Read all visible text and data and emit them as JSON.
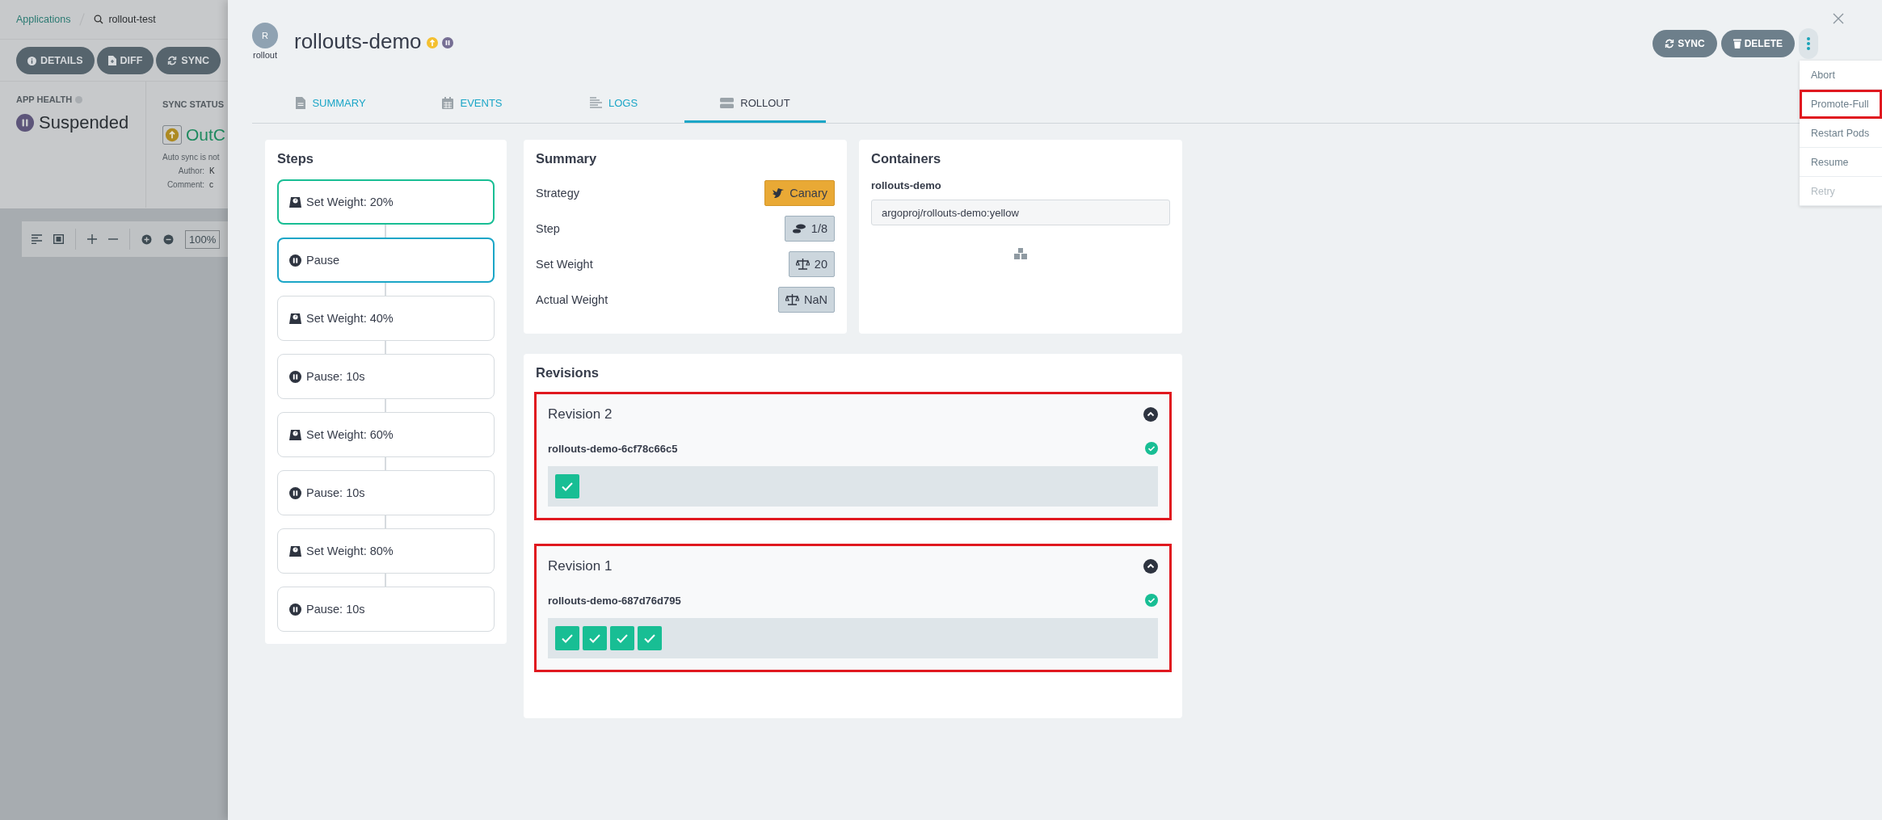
{
  "background_app": {
    "breadcrumb": {
      "root": "Applications",
      "current": "rollout-test"
    },
    "buttons": [
      {
        "label": "DETAILS",
        "kind": "info"
      },
      {
        "label": "DIFF",
        "kind": "diff"
      },
      {
        "label": "SYNC",
        "kind": "sync"
      }
    ],
    "app_health": {
      "label": "APP HEALTH",
      "status": "Suspended"
    },
    "sync_status": {
      "label": "SYNC STATUS",
      "status": "OutC",
      "note": "Auto sync is not",
      "fields": [
        {
          "label": "Author:",
          "value": "K"
        },
        {
          "label": "Comment:",
          "value": "c"
        }
      ]
    },
    "graph_toolbar": {
      "zoom": "100%"
    }
  },
  "resource": {
    "avatar": "R",
    "kind": "rollout",
    "name": "rollouts-demo"
  },
  "actions": [
    {
      "label": "SYNC",
      "kind": "sync"
    },
    {
      "label": "DELETE",
      "kind": "delete"
    }
  ],
  "menu": [
    {
      "label": "Abort",
      "disabled": false,
      "highlighted": false
    },
    {
      "label": "Promote-Full",
      "disabled": false,
      "highlighted": true
    },
    {
      "label": "Restart Pods",
      "disabled": false,
      "highlighted": false
    },
    {
      "label": "Resume",
      "disabled": false,
      "highlighted": false
    },
    {
      "label": "Retry",
      "disabled": true,
      "highlighted": false
    }
  ],
  "tabs": [
    {
      "label": "SUMMARY",
      "kind": "file",
      "selected": false
    },
    {
      "label": "EVENTS",
      "kind": "calendar",
      "selected": false
    },
    {
      "label": "LOGS",
      "kind": "lines",
      "selected": false
    },
    {
      "label": "ROLLOUT",
      "kind": "server",
      "selected": true
    }
  ],
  "steps": {
    "title": "Steps",
    "items": [
      {
        "kind": "weight",
        "label": "Set Weight: 20%",
        "completed": true,
        "current": false
      },
      {
        "kind": "pause",
        "label": "Pause",
        "completed": false,
        "current": true
      },
      {
        "kind": "weight",
        "label": "Set Weight: 40%",
        "completed": false,
        "current": false
      },
      {
        "kind": "pause",
        "label": "Pause: 10s",
        "completed": false,
        "current": false
      },
      {
        "kind": "weight",
        "label": "Set Weight: 60%",
        "completed": false,
        "current": false
      },
      {
        "kind": "pause",
        "label": "Pause: 10s",
        "completed": false,
        "current": false
      },
      {
        "kind": "weight",
        "label": "Set Weight: 80%",
        "completed": false,
        "current": false
      },
      {
        "kind": "pause",
        "label": "Pause: 10s",
        "completed": false,
        "current": false
      }
    ]
  },
  "summary": {
    "title": "Summary",
    "rows": [
      {
        "label": "Strategy",
        "value": "Canary",
        "kind": "strategy"
      },
      {
        "label": "Step",
        "value": "1/8",
        "kind": "step"
      },
      {
        "label": "Set Weight",
        "value": "20",
        "kind": "weight"
      },
      {
        "label": "Actual Weight",
        "value": "NaN",
        "kind": "weight"
      }
    ]
  },
  "containers": {
    "title": "Containers",
    "items": [
      {
        "name": "rollouts-demo",
        "image": "argoproj/rollouts-demo:yellow"
      }
    ]
  },
  "revisions": {
    "title": "Revisions",
    "items": [
      {
        "title": "Revision 2",
        "highlighted": true,
        "expanded": true,
        "replica_set": "rollouts-demo-6cf78c66c5",
        "pods": [
          {
            "ready": true
          }
        ]
      },
      {
        "title": "Revision 1",
        "highlighted": true,
        "expanded": true,
        "replica_set": "rollouts-demo-687d76d795",
        "pods": [
          {
            "ready": true
          },
          {
            "ready": true
          },
          {
            "ready": true
          },
          {
            "ready": true
          }
        ]
      }
    ]
  }
}
